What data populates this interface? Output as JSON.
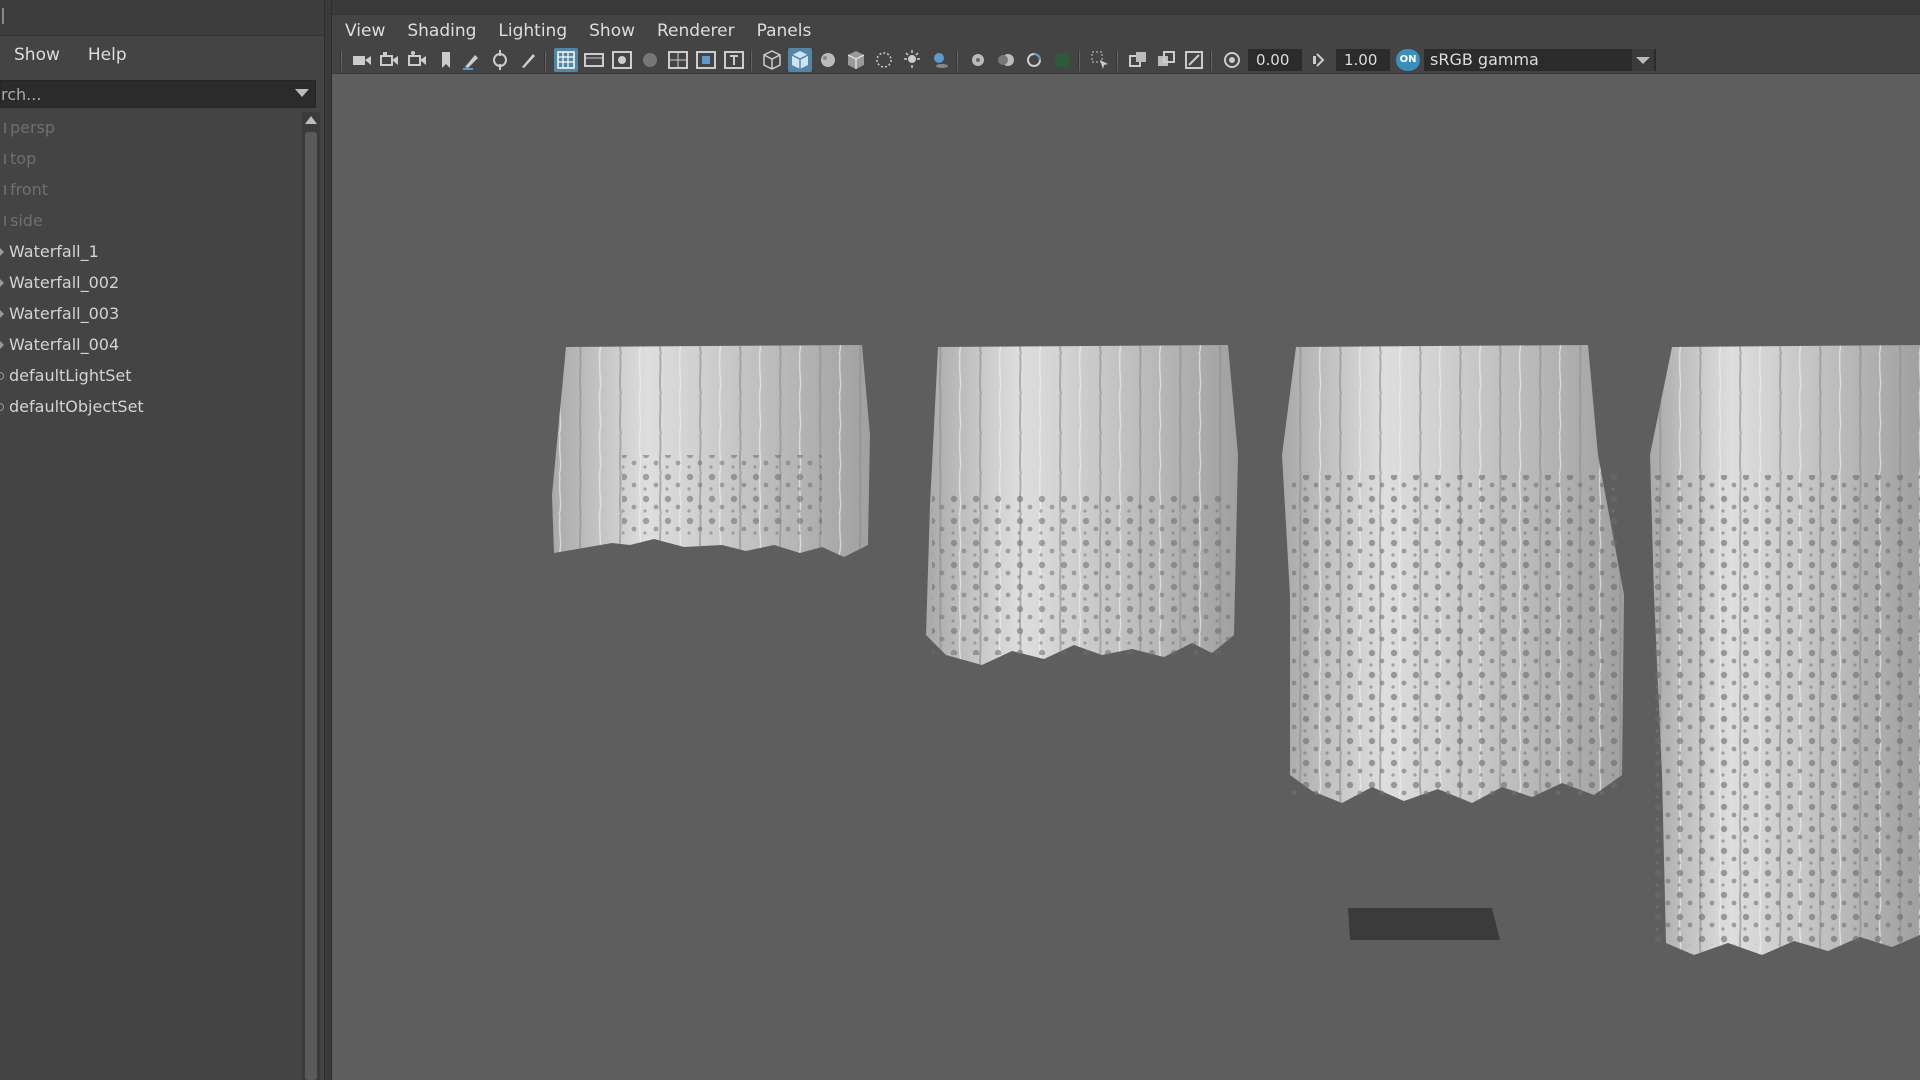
{
  "outliner": {
    "menu": [
      "Show",
      "Help"
    ],
    "search_placeholder": "rch...",
    "items": [
      {
        "label": "persp",
        "kind": "camera"
      },
      {
        "label": "top",
        "kind": "camera"
      },
      {
        "label": "front",
        "kind": "camera"
      },
      {
        "label": "side",
        "kind": "camera"
      },
      {
        "label": "Waterfall_1",
        "kind": "mesh"
      },
      {
        "label": "Waterfall_002",
        "kind": "mesh"
      },
      {
        "label": "Waterfall_003",
        "kind": "mesh"
      },
      {
        "label": "Waterfall_004",
        "kind": "mesh"
      },
      {
        "label": "defaultLightSet",
        "kind": "set"
      },
      {
        "label": "defaultObjectSet",
        "kind": "set"
      }
    ]
  },
  "viewport": {
    "menu": [
      "View",
      "Shading",
      "Lighting",
      "Show",
      "Renderer",
      "Panels"
    ],
    "exposure": "0.00",
    "gamma": "1.00",
    "color_management_badge": "ON",
    "color_space": "sRGB gamma"
  },
  "colors": {
    "viewport_bg": "#5e5e5e",
    "panel_bg": "#444444",
    "accent": "#5285a6",
    "mesh": "#c8c8c8"
  }
}
